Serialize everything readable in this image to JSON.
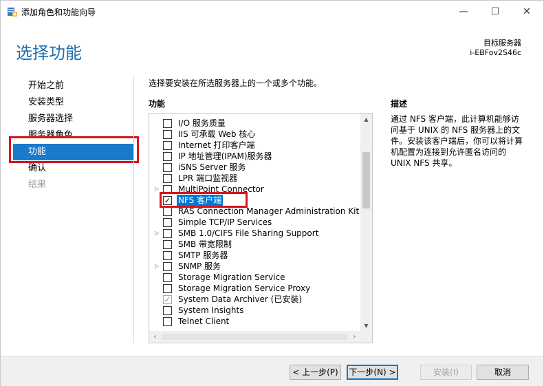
{
  "window": {
    "title": "添加角色和功能向导",
    "minimize_glyph": "—",
    "maximize_glyph": "☐",
    "close_glyph": "✕"
  },
  "header": {
    "page_title": "选择功能",
    "destination_label": "目标服务器",
    "destination_server": "i-EBFov2S46c"
  },
  "nav": {
    "items": [
      {
        "label": "开始之前",
        "state": "normal"
      },
      {
        "label": "安装类型",
        "state": "normal"
      },
      {
        "label": "服务器选择",
        "state": "normal"
      },
      {
        "label": "服务器角色",
        "state": "normal"
      },
      {
        "label": "功能",
        "state": "active"
      },
      {
        "label": "确认",
        "state": "normal"
      },
      {
        "label": "结果",
        "state": "disabled"
      }
    ]
  },
  "content": {
    "instruction": "选择要安装在所选服务器上的一个或多个功能。",
    "features_header": "功能",
    "description_header": "描述",
    "description_text": "通过 NFS 客户端，此计算机能够访问基于 UNIX 的 NFS 服务器上的文件。安装该客户端后，你可以将计算机配置为连接到允许匿名访问的 UNIX NFS 共享。"
  },
  "features": [
    {
      "label": "I/O 服务质量",
      "expandable": false,
      "checked": false,
      "installed": false,
      "selected": false
    },
    {
      "label": "IIS 可承载 Web 核心",
      "expandable": false,
      "checked": false,
      "installed": false,
      "selected": false
    },
    {
      "label": "Internet 打印客户端",
      "expandable": false,
      "checked": false,
      "installed": false,
      "selected": false
    },
    {
      "label": "IP 地址管理(IPAM)服务器",
      "expandable": false,
      "checked": false,
      "installed": false,
      "selected": false
    },
    {
      "label": "iSNS Server 服务",
      "expandable": false,
      "checked": false,
      "installed": false,
      "selected": false
    },
    {
      "label": "LPR 端口监视器",
      "expandable": false,
      "checked": false,
      "installed": false,
      "selected": false
    },
    {
      "label": "MultiPoint Connector",
      "expandable": true,
      "checked": false,
      "installed": false,
      "selected": false
    },
    {
      "label": "NFS 客户端",
      "expandable": false,
      "checked": true,
      "installed": false,
      "selected": true
    },
    {
      "label": "RAS Connection Manager Administration Kit (C",
      "expandable": false,
      "checked": false,
      "installed": false,
      "selected": false
    },
    {
      "label": "Simple TCP/IP Services",
      "expandable": false,
      "checked": false,
      "installed": false,
      "selected": false
    },
    {
      "label": "SMB 1.0/CIFS File Sharing Support",
      "expandable": true,
      "checked": false,
      "installed": false,
      "selected": false
    },
    {
      "label": "SMB 带宽限制",
      "expandable": false,
      "checked": false,
      "installed": false,
      "selected": false
    },
    {
      "label": "SMTP 服务器",
      "expandable": false,
      "checked": false,
      "installed": false,
      "selected": false
    },
    {
      "label": "SNMP 服务",
      "expandable": true,
      "checked": false,
      "installed": false,
      "selected": false
    },
    {
      "label": "Storage Migration Service",
      "expandable": false,
      "checked": false,
      "installed": false,
      "selected": false
    },
    {
      "label": "Storage Migration Service Proxy",
      "expandable": false,
      "checked": false,
      "installed": false,
      "selected": false
    },
    {
      "label": "System Data Archiver (已安装)",
      "expandable": false,
      "checked": true,
      "installed": true,
      "selected": false
    },
    {
      "label": "System Insights",
      "expandable": false,
      "checked": false,
      "installed": false,
      "selected": false
    },
    {
      "label": "Telnet Client",
      "expandable": false,
      "checked": false,
      "installed": false,
      "selected": false
    }
  ],
  "footer": {
    "back_label": "< 上一步(P)",
    "next_label": "下一步(N) >",
    "install_label": "安装(I)",
    "cancel_label": "取消"
  },
  "colors": {
    "accent": "#1979ca",
    "title_blue": "#1e6fb0",
    "highlight_red": "#d9141b",
    "selection_blue": "#0078d7"
  }
}
